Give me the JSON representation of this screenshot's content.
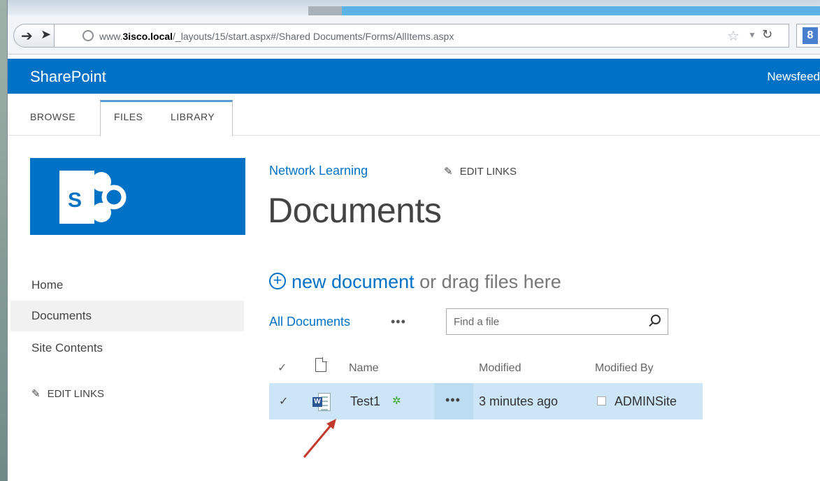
{
  "browser": {
    "url_prefix": "www.",
    "url_host": "3isco.local",
    "url_rest": "/_layouts/15/start.aspx#/Shared Documents/Forms/AllItems.aspx",
    "google_label": "8"
  },
  "suite_bar": {
    "brand": "SharePoint",
    "right_link": "Newsfeed"
  },
  "ribbon": {
    "tabs": [
      {
        "label": "BROWSE"
      },
      {
        "label": "FILES"
      },
      {
        "label": "LIBRARY"
      }
    ],
    "active_tab": "FILES"
  },
  "left_nav": {
    "items": [
      {
        "label": "Home"
      },
      {
        "label": "Documents"
      },
      {
        "label": "Site Contents"
      }
    ],
    "selected": "Documents",
    "edit_links": "EDIT LINKS"
  },
  "header": {
    "breadcrumb": "Network Learning",
    "edit_links": "EDIT LINKS",
    "title": "Documents"
  },
  "actions": {
    "new_document": "new document",
    "drag_text": " or drag files here",
    "view_name": "All Documents",
    "view_more": "•••",
    "search_placeholder": "Find a file"
  },
  "table": {
    "columns": {
      "check": "✓",
      "name": "Name",
      "modified": "Modified",
      "modified_by": "Modified By"
    },
    "rows": [
      {
        "check": "✓",
        "name": "Test1",
        "new_badge": "✲",
        "more": "•••",
        "modified": "3 minutes ago",
        "modified_by": "ADMINSite"
      }
    ]
  },
  "colors": {
    "brand_blue": "#0072c6",
    "selected_row": "#cde6f7",
    "annotation_arrow": "#c0392b"
  }
}
